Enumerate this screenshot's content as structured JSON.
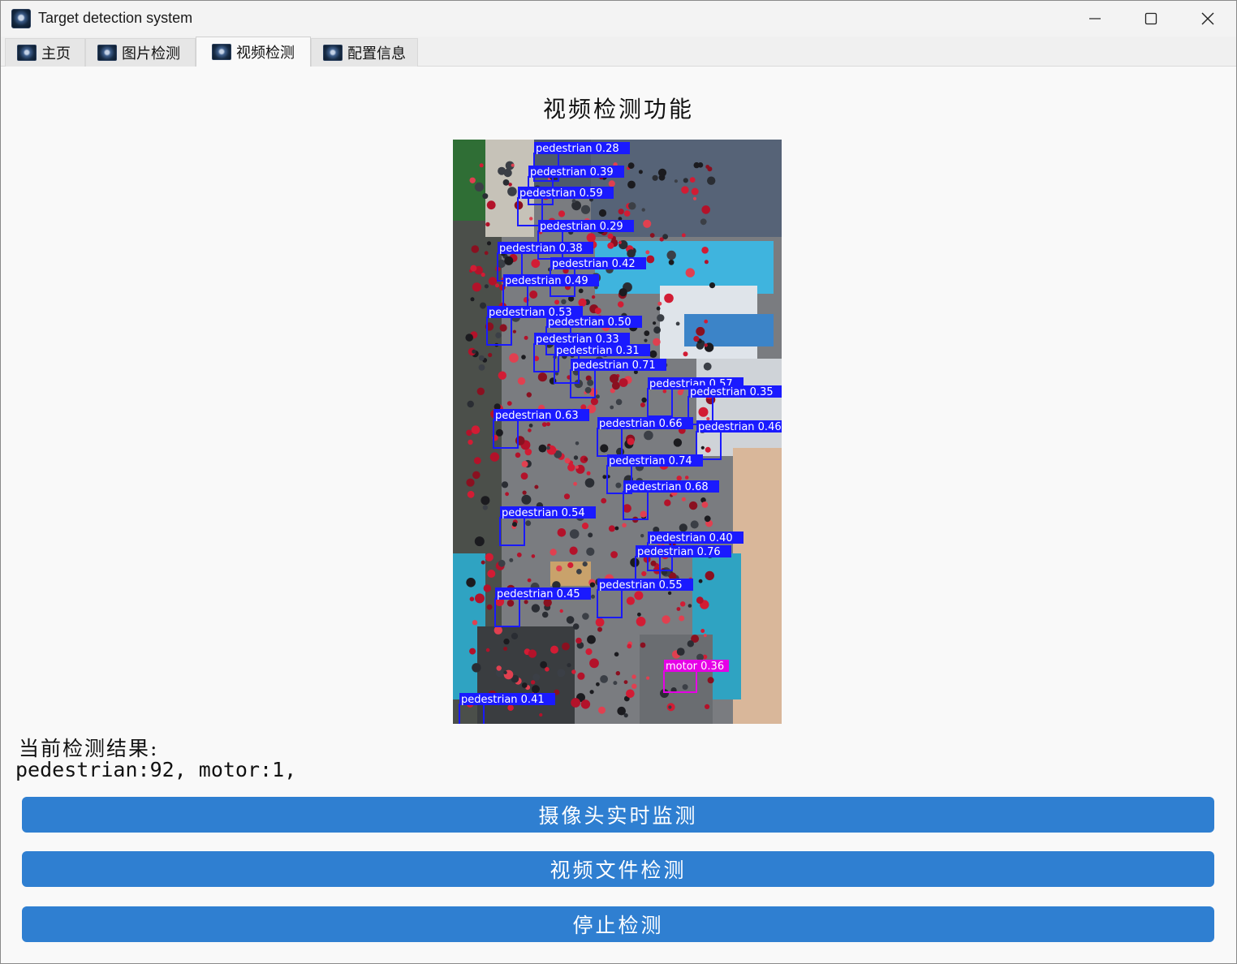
{
  "window": {
    "title": "Target detection system"
  },
  "tabs": [
    {
      "label": "主页",
      "icon": "app-logo-icon"
    },
    {
      "label": "图片检测",
      "icon": "app-logo-icon"
    },
    {
      "label": "视频检测",
      "icon": "app-logo-icon",
      "active": true
    },
    {
      "label": "配置信息",
      "icon": "app-logo-icon"
    }
  ],
  "page": {
    "heading": "视频检测功能",
    "result_label": "当前检测结果:",
    "result_value": "pedestrian:92, motor:1,"
  },
  "video": {
    "detections": [
      {
        "label": "pedestrian 0.28"
      },
      {
        "label": "pedestrian 0.39"
      },
      {
        "label": "pedestrian 0.59"
      },
      {
        "label": "pedestrian 0.29"
      },
      {
        "label": "pedestrian 0.38"
      },
      {
        "label": "pedestrian 0.42"
      },
      {
        "label": "pedestrian 0.49"
      },
      {
        "label": "pedestrian 0.53"
      },
      {
        "label": "pedestrian 0.50"
      },
      {
        "label": "pedestrian 0.33"
      },
      {
        "label": "pedestrian 0.31"
      },
      {
        "label": "pedestrian 0.71"
      },
      {
        "label": "pedestrian 0.57"
      },
      {
        "label": "pedestrian 0.35"
      },
      {
        "label": "pedestrian 0.63"
      },
      {
        "label": "pedestrian 0.66"
      },
      {
        "label": "pedestrian 0.46"
      },
      {
        "label": "pedestrian 0.74"
      },
      {
        "label": "pedestrian 0.68"
      },
      {
        "label": "pedestrian 0.54"
      },
      {
        "label": "pedestrian 0.40"
      },
      {
        "label": "pedestrian 0.76"
      },
      {
        "label": "pedestrian 0.55"
      },
      {
        "label": "pedestrian 0.45"
      },
      {
        "label": "motor 0.36"
      },
      {
        "label": "pedestrian 0.41"
      }
    ],
    "box_color_pedestrian": "#1a1aff",
    "box_color_motor": "#e600e6"
  },
  "buttons": {
    "camera": "摄像头实时监测",
    "video_file": "视频文件检测",
    "stop": "停止检测"
  },
  "colors": {
    "button_bg": "#2f7fd1",
    "window_bg": "#f9f9f9"
  }
}
